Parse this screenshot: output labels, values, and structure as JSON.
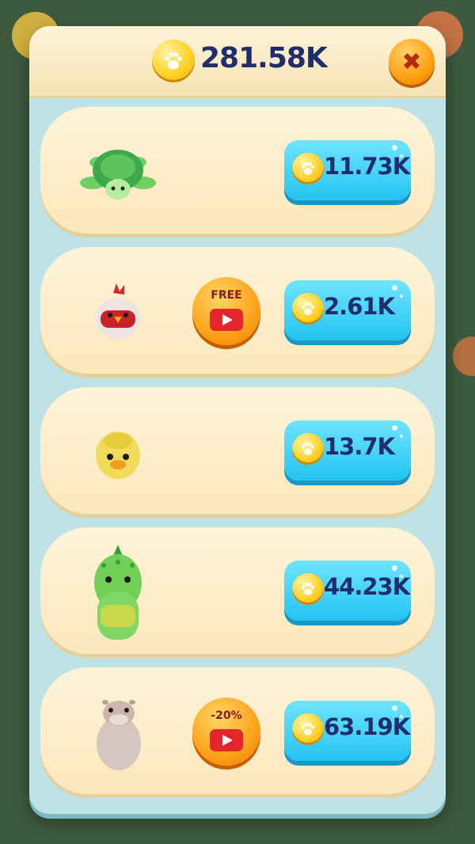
{
  "header": {
    "balance": "281.58K",
    "coin_icon": "paw-coin-icon",
    "close_icon": "close-icon"
  },
  "animals": [
    {
      "name": "turtle",
      "price": "11.73K",
      "ad": null
    },
    {
      "name": "rooster",
      "price": "2.61K",
      "ad": "FREE"
    },
    {
      "name": "duck",
      "price": "13.7K",
      "ad": null
    },
    {
      "name": "crocodile",
      "price": "44.23K",
      "ad": null
    },
    {
      "name": "capybara",
      "price": "63.19K",
      "ad": "-20%"
    }
  ],
  "colors": {
    "price_button": "#24c3f2",
    "ad_button": "#ffa21a",
    "panel": "#bfe2e6",
    "row": "#fbe7bc"
  }
}
